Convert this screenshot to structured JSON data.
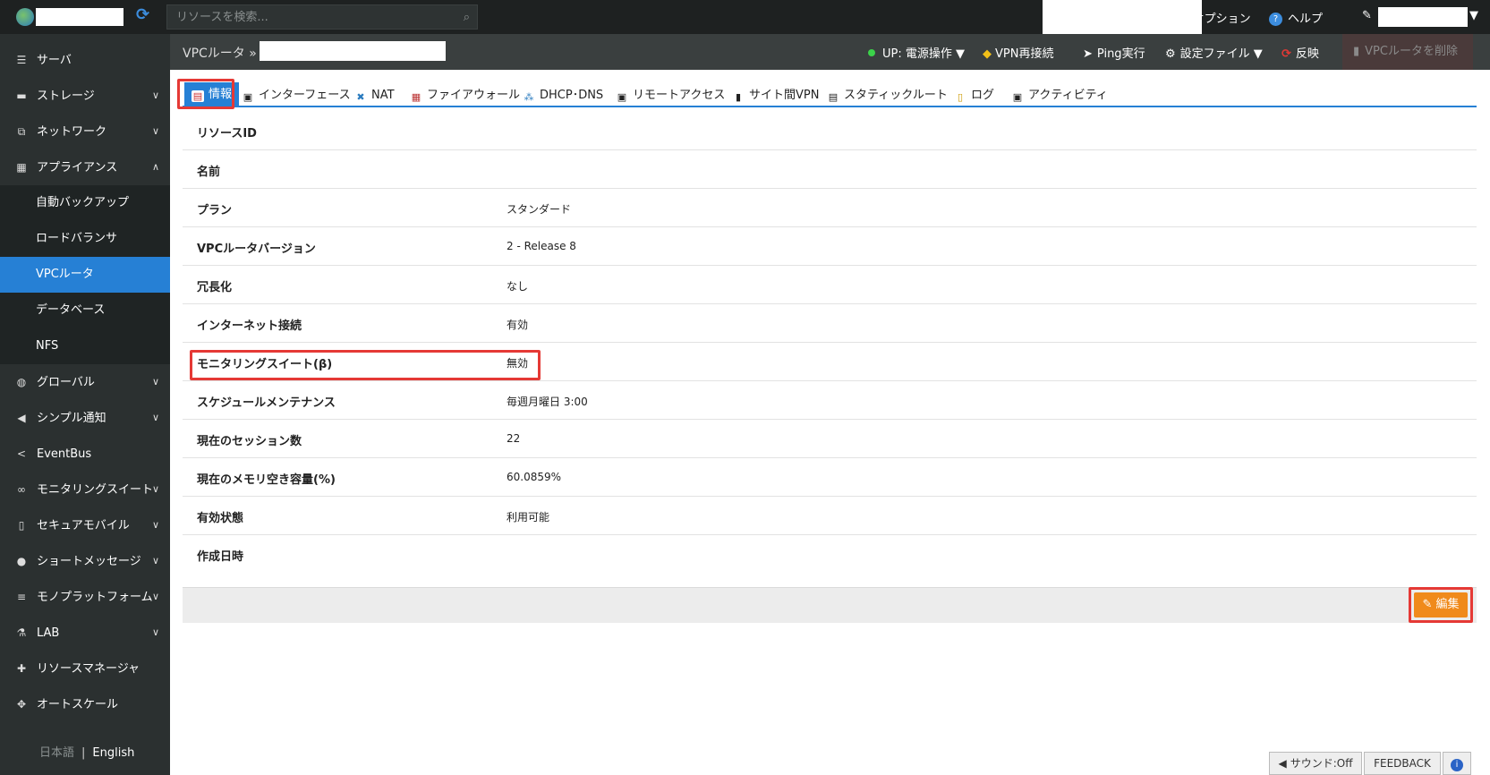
{
  "topbar": {
    "search_placeholder": "リソースを検索...",
    "options_label": "オプション",
    "help_label": "ヘルプ",
    "user_caret": "▼"
  },
  "sidebar": {
    "items": [
      {
        "label": "サーバ",
        "icon": "server-icon"
      },
      {
        "label": "ストレージ",
        "icon": "storage-icon"
      },
      {
        "label": "ネットワーク",
        "icon": "network-icon"
      },
      {
        "label": "アプライアンス",
        "icon": "appliance-icon"
      },
      {
        "label": "自動バックアップ"
      },
      {
        "label": "ロードバランサ"
      },
      {
        "label": "VPCルータ"
      },
      {
        "label": "データベース"
      },
      {
        "label": "NFS"
      },
      {
        "label": "グローバル",
        "icon": "globe-icon"
      },
      {
        "label": "シンプル通知",
        "icon": "megaphone-icon"
      },
      {
        "label": "EventBus",
        "icon": "share-icon"
      },
      {
        "label": "モニタリングスイート",
        "icon": "binoculars-icon"
      },
      {
        "label": "セキュアモバイル",
        "icon": "mobile-icon"
      },
      {
        "label": "ショートメッセージ",
        "icon": "chat-icon"
      },
      {
        "label": "モノプラットフォーム",
        "icon": "stack-icon"
      },
      {
        "label": "LAB",
        "icon": "flask-icon"
      },
      {
        "label": "リソースマネージャ",
        "icon": "puzzle-icon"
      },
      {
        "label": "オートスケール",
        "icon": "move-icon"
      }
    ],
    "lang_ja": "日本語",
    "lang_sep": "|",
    "lang_en": "English"
  },
  "header": {
    "breadcrumb": "VPCルータ »",
    "power": "UP: 電源操作 ▼",
    "vpn_reconnect": "VPN再接続",
    "ping": "Ping実行",
    "config_file": "設定ファイル ▼",
    "apply": "反映",
    "delete": "VPCルータを削除"
  },
  "tabs": [
    {
      "label": "情報",
      "icon": "info-card-icon"
    },
    {
      "label": "インターフェース",
      "icon": "monitor-icon"
    },
    {
      "label": "NAT",
      "icon": "nat-icon"
    },
    {
      "label": "ファイアウォール",
      "icon": "firewall-icon"
    },
    {
      "label": "DHCP･DNS",
      "icon": "dhcp-icon"
    },
    {
      "label": "リモートアクセス",
      "icon": "remote-icon"
    },
    {
      "label": "サイト間VPN",
      "icon": "vpn-icon"
    },
    {
      "label": "スタティックルート",
      "icon": "route-icon"
    },
    {
      "label": "ログ",
      "icon": "log-icon"
    },
    {
      "label": "アクティビティ",
      "icon": "activity-icon"
    }
  ],
  "info": {
    "rows": [
      {
        "key": "リソースID",
        "value": ""
      },
      {
        "key": "名前",
        "value": ""
      },
      {
        "key": "プラン",
        "value": "スタンダード"
      },
      {
        "key": "VPCルータバージョン",
        "value": "2 - Release 8"
      },
      {
        "key": "冗長化",
        "value": "なし"
      },
      {
        "key": "インターネット接続",
        "value": "有効"
      },
      {
        "key": "モニタリングスイート(β)",
        "value": "無効"
      },
      {
        "key": "スケジュールメンテナンス",
        "value": "毎週月曜日 3:00"
      },
      {
        "key": "現在のセッション数",
        "value": "22"
      },
      {
        "key": "現在のメモリ空き容量(%)",
        "value": "60.0859%"
      },
      {
        "key": "有効状態",
        "value": "利用可能"
      },
      {
        "key": "作成日時",
        "value": ""
      }
    ]
  },
  "edit_button": "編集",
  "bottom": {
    "sound": "サウンド:Off",
    "feedback": "FEEDBACK",
    "info": "i"
  },
  "colors": {
    "accent": "#2680d5",
    "highlight": "#e53935",
    "edit": "#f08a1b",
    "sidebar_bg": "#2b3030"
  }
}
